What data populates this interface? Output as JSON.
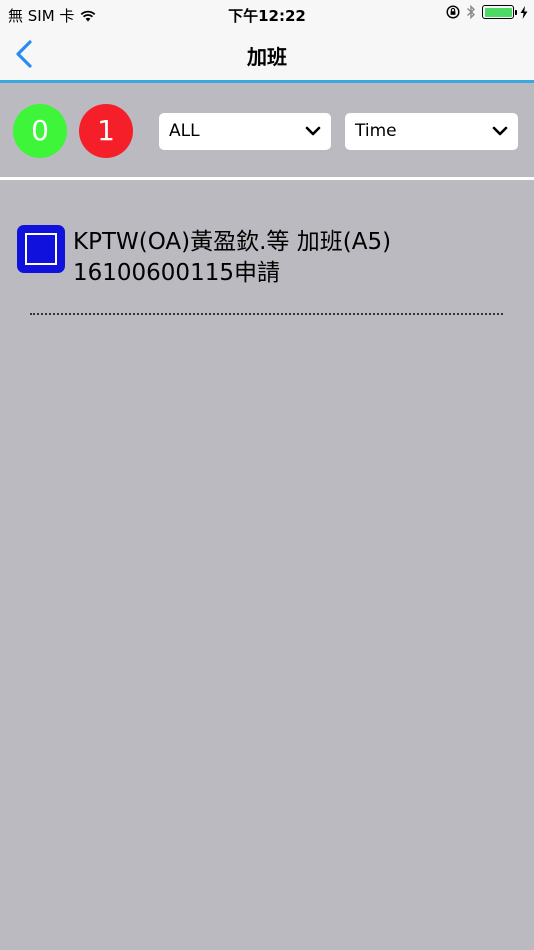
{
  "status_bar": {
    "carrier": "無 SIM 卡",
    "time": "下午12:22"
  },
  "nav": {
    "title": "加班",
    "back_icon": "chevron-left-icon",
    "accent_color": "#2a8bf2",
    "border_color": "#3aa8de"
  },
  "toolbar": {
    "count_green": "0",
    "count_red": "1",
    "green_color": "#3ef53a",
    "red_color": "#f51f2a",
    "filter_select": {
      "selected": "ALL"
    },
    "sort_select": {
      "selected": "Time"
    }
  },
  "list": {
    "items": [
      {
        "line1": "KPTW(OA)黃盈欽.等 加班(A5)",
        "line2": "16100600115申請",
        "icon": "checkbox-square-icon",
        "icon_color": "#1111dd"
      }
    ]
  }
}
